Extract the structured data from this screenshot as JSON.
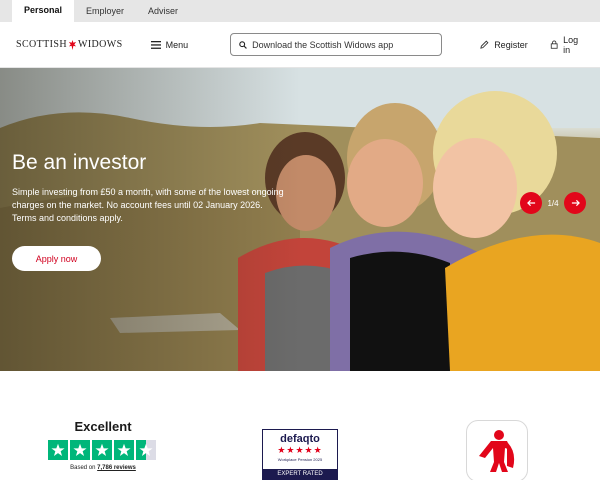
{
  "audience_tabs": [
    {
      "label": "Personal",
      "active": true
    },
    {
      "label": "Employer",
      "active": false
    },
    {
      "label": "Adviser",
      "active": false
    }
  ],
  "header": {
    "logo_left": "SCOTTISH",
    "logo_right": "WIDOWS",
    "menu_label": "Menu",
    "search_placeholder": "Download the Scottish Widows app",
    "register_label": "Register",
    "login_label": "Log in"
  },
  "hero": {
    "title": "Be an investor",
    "text": "Simple investing from £50 a month, with some of the lowest ongoing charges on the market. No account fees until 02 January 2026. Terms and conditions apply.",
    "cta_label": "Apply now",
    "slide_counter": "1/4"
  },
  "ratings": {
    "trustpilot_label": "Excellent",
    "trustpilot_stars": 4.5,
    "reviews_prefix": "Based on",
    "reviews_count": "7,786 reviews",
    "defaqto_brand": "defaqto",
    "defaqto_stars": 5,
    "defaqto_subtitle": "Workplace Pension 2025",
    "defaqto_badge": "EXPERT RATED"
  },
  "colors": {
    "brand_red": "#e2061a",
    "trustpilot_green": "#00b67a",
    "defaqto_navy": "#1c1a4f"
  },
  "icons": [
    "thistle-icon",
    "hamburger-icon",
    "search-icon",
    "pencil-icon",
    "lock-icon",
    "arrow-left-icon",
    "arrow-right-icon",
    "star-icon",
    "widow-icon"
  ]
}
